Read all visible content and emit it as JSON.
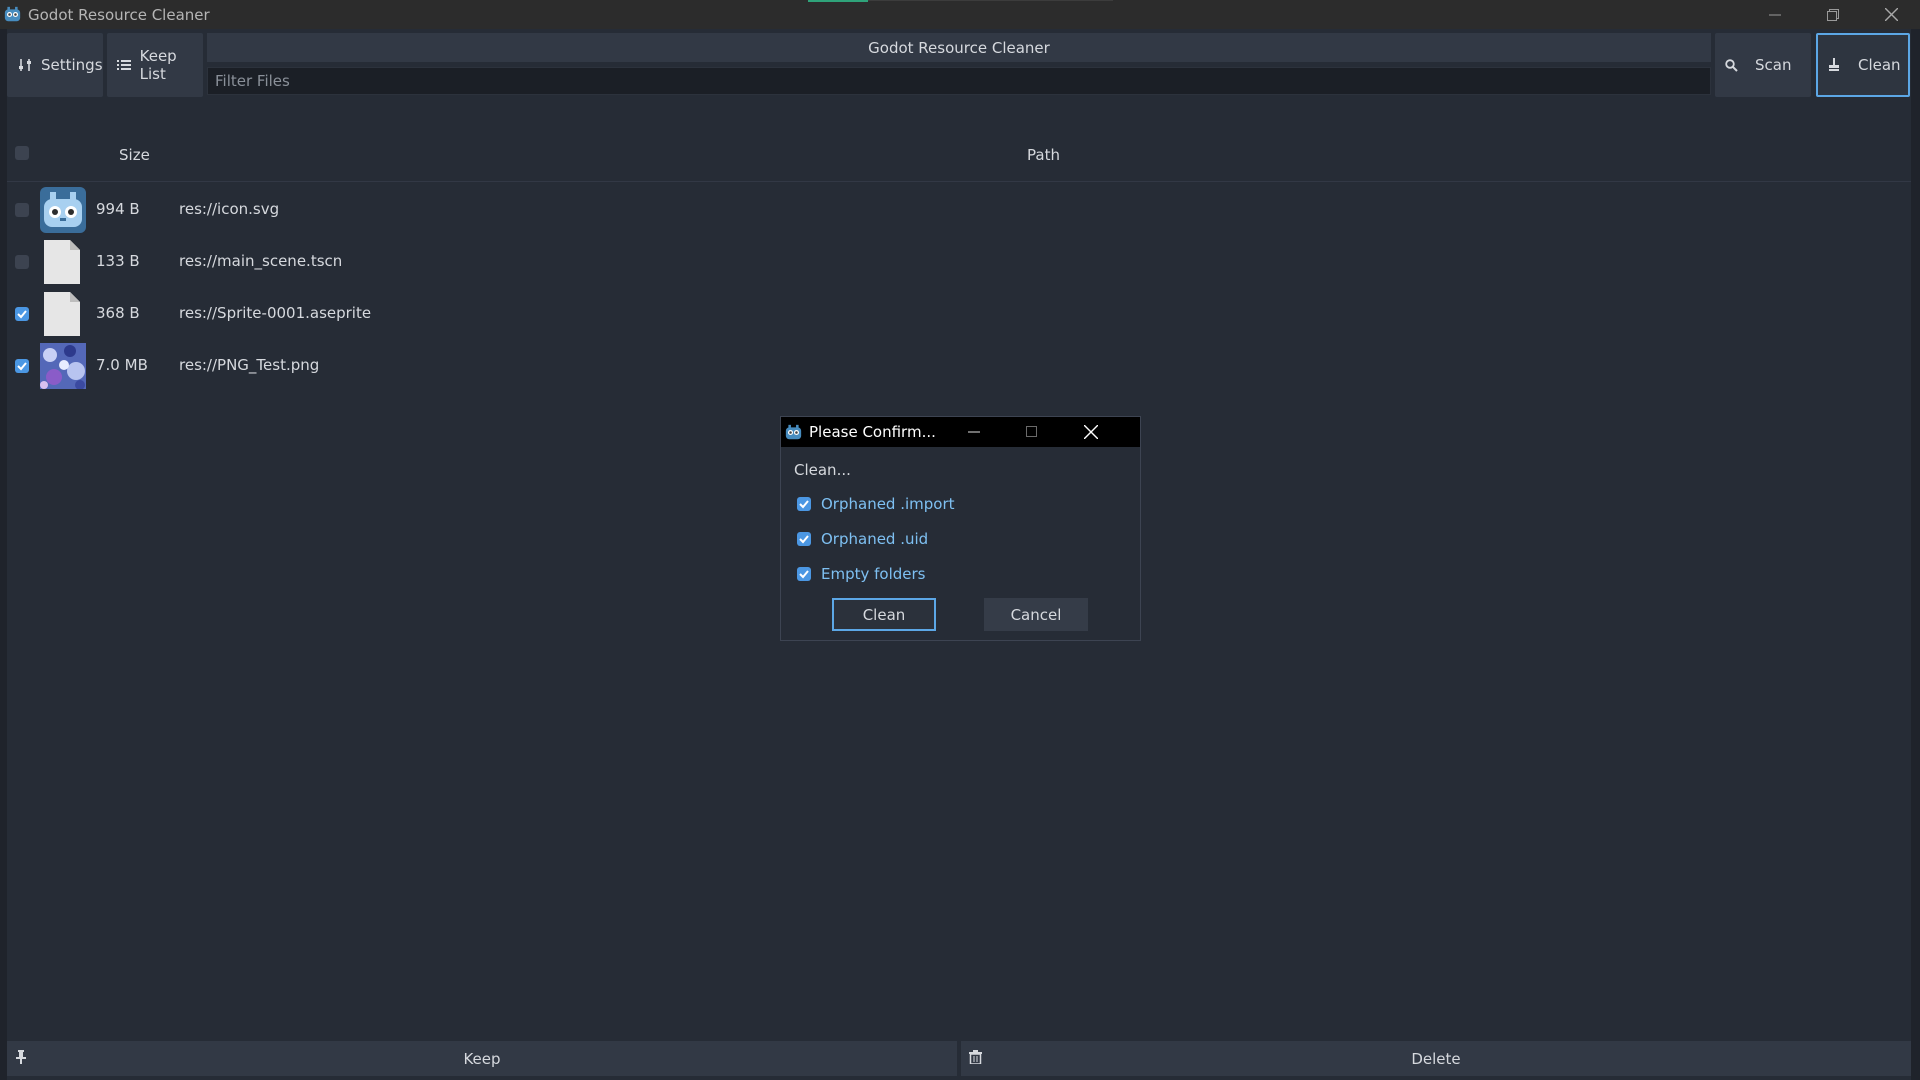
{
  "window": {
    "title": "Godot Resource Cleaner",
    "controls": [
      "minimize-icon",
      "restore-icon",
      "close-icon"
    ]
  },
  "toolbar": {
    "settings_label": "Settings",
    "keeplist_label": "Keep List",
    "center_title": "Godot Resource Cleaner",
    "filter_placeholder": "Filter Files",
    "filter_value": "",
    "scan_label": "Scan",
    "clean_label": "Clean"
  },
  "table": {
    "columns": {
      "size": "Size",
      "path": "Path"
    },
    "rows": [
      {
        "checked": false,
        "size": "994 B",
        "path": "res://icon.svg",
        "thumb": "godot-icon"
      },
      {
        "checked": false,
        "size": "133 B",
        "path": "res://main_scene.tscn",
        "thumb": "file-icon"
      },
      {
        "checked": true,
        "size": "368 B",
        "path": "res://Sprite-0001.aseprite",
        "thumb": "file-icon"
      },
      {
        "checked": true,
        "size": "7.0 MB",
        "path": "res://PNG_Test.png",
        "thumb": "image-thumbnail"
      }
    ]
  },
  "bottom": {
    "keep_label": "Keep",
    "delete_label": "Delete"
  },
  "dialog": {
    "title": "Please Confirm...",
    "label": "Clean...",
    "options": [
      {
        "label": "Orphaned .import",
        "checked": true
      },
      {
        "label": "Orphaned .uid",
        "checked": true
      },
      {
        "label": "Empty folders",
        "checked": true
      }
    ],
    "ok_label": "Clean",
    "cancel_label": "Cancel"
  },
  "colors": {
    "accent": "#5ca7e6",
    "checkbox_on": "#4b97e3",
    "option_text": "#7ec0f2",
    "background": "#262c36"
  }
}
